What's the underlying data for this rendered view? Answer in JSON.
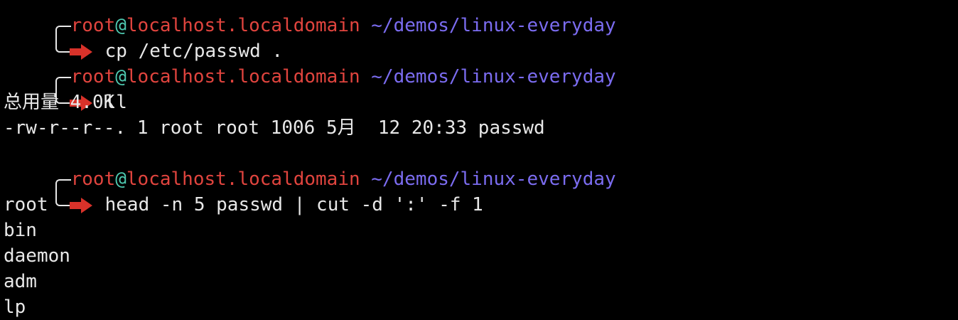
{
  "prompt": {
    "user": "root",
    "at": "@",
    "host": "localhost.localdomain",
    "path": "~/demos/linux-everyday",
    "previous_line_fragment": "root@localhost.localdomain ~/demos/linux-everyday"
  },
  "blocks": [
    {
      "command": "cp /etc/passwd .",
      "output": []
    },
    {
      "command": "ll",
      "output": [
        "总用量 4.0K",
        "-rw-r--r--. 1 root root 1006 5月  12 20:33 passwd"
      ]
    },
    {
      "command": "head -n 5 passwd | cut -d ':' -f 1",
      "output": [
        "root",
        "bin",
        "daemon",
        "adm",
        "lp"
      ]
    }
  ],
  "colors": {
    "background": "#000000",
    "text": "#e8e8e8",
    "user_host": "#e0443e",
    "at_sign": "#4ec9b0",
    "path": "#7b6cf0",
    "arrow": "#d8322a"
  }
}
